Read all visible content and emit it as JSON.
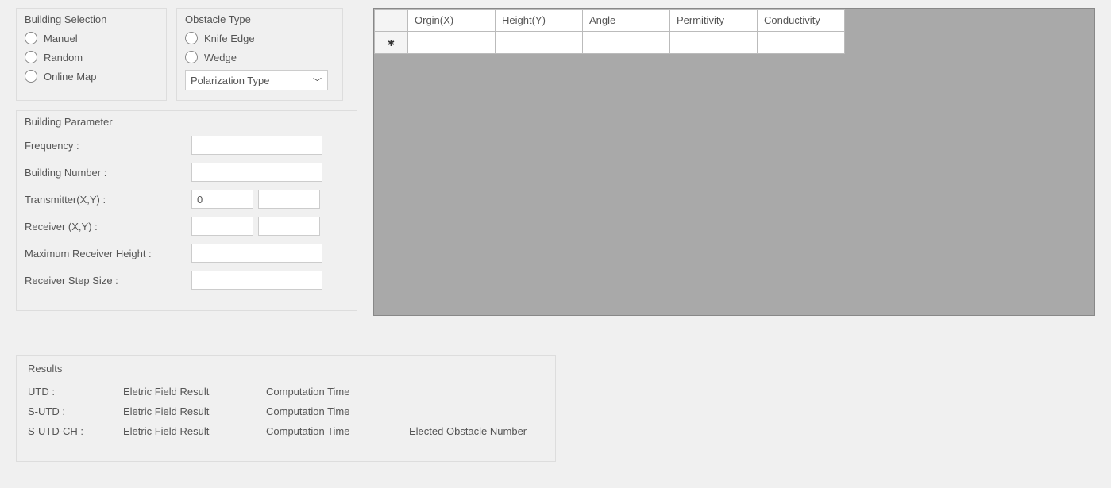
{
  "buildingSelection": {
    "title": "Building Selection",
    "options": [
      "Manuel",
      "Random",
      "Online Map"
    ]
  },
  "obstacleType": {
    "title": "Obstacle Type",
    "options": [
      "Knife Edge",
      "Wedge"
    ],
    "selectLabel": "Polarization Type"
  },
  "buildingParameter": {
    "title": "Building Parameter",
    "rows": {
      "frequency": {
        "label": "Frequency :",
        "value": ""
      },
      "buildingNumber": {
        "label": "Building Number :",
        "value": ""
      },
      "transmitter": {
        "label": "Transmitter(X,Y) :",
        "x": "0",
        "y": ""
      },
      "receiver": {
        "label": "Receiver (X,Y) :",
        "x": "",
        "y": ""
      },
      "maxReceiverHeight": {
        "label": "Maximum Receiver Height :",
        "value": ""
      },
      "receiverStepSize": {
        "label": "Receiver Step Size :",
        "value": ""
      }
    }
  },
  "grid": {
    "columns": [
      "Orgin(X)",
      "Height(Y)",
      "Angle",
      "Permitivity",
      "Conductivity"
    ],
    "rowMarker": "✱"
  },
  "results": {
    "title": "Results",
    "rows": [
      {
        "method": "UTD :",
        "field": "Eletric Field Result",
        "time": "Computation Time",
        "extra": ""
      },
      {
        "method": "S-UTD :",
        "field": "Eletric Field Result",
        "time": "Computation Time",
        "extra": ""
      },
      {
        "method": "S-UTD-CH :",
        "field": "Eletric Field Result",
        "time": "Computation Time",
        "extra": "Elected Obstacle Number"
      }
    ]
  }
}
